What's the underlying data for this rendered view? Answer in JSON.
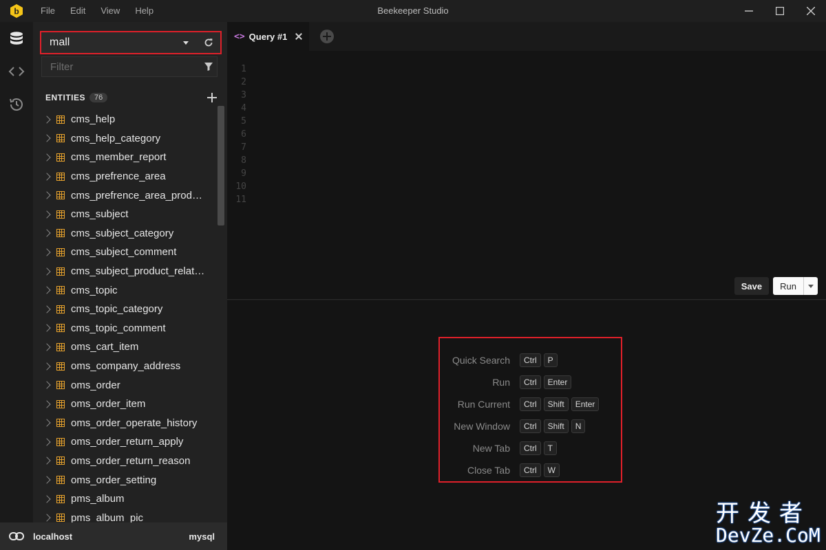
{
  "titlebar": {
    "menu": [
      "File",
      "Edit",
      "View",
      "Help"
    ],
    "title": "Beekeeper Studio"
  },
  "rail": {
    "items": [
      "database-icon",
      "code-icon",
      "history-icon"
    ]
  },
  "sidebar": {
    "database": "mall",
    "filter_placeholder": "Filter",
    "entities_label": "ENTITIES",
    "entities_count": "76",
    "tables": [
      "cms_help",
      "cms_help_category",
      "cms_member_report",
      "cms_prefrence_area",
      "cms_prefrence_area_produ…",
      "cms_subject",
      "cms_subject_category",
      "cms_subject_comment",
      "cms_subject_product_relat…",
      "cms_topic",
      "cms_topic_category",
      "cms_topic_comment",
      "oms_cart_item",
      "oms_company_address",
      "oms_order",
      "oms_order_item",
      "oms_order_operate_history",
      "oms_order_return_apply",
      "oms_order_return_reason",
      "oms_order_setting",
      "pms_album",
      "pms_album_pic"
    ]
  },
  "statusbar": {
    "host": "localhost",
    "db_type": "mysql"
  },
  "tabs": [
    {
      "label": "Query #1"
    }
  ],
  "editor": {
    "line_numbers": [
      "1",
      "2",
      "3",
      "4",
      "5",
      "6",
      "7",
      "8",
      "9",
      "10",
      "11"
    ],
    "save_label": "Save",
    "run_label": "Run"
  },
  "shortcuts": [
    {
      "name": "Quick Search",
      "keys": [
        "Ctrl",
        "P"
      ]
    },
    {
      "name": "Run",
      "keys": [
        "Ctrl",
        "Enter"
      ]
    },
    {
      "name": "Run Current",
      "keys": [
        "Ctrl",
        "Shift",
        "Enter"
      ]
    },
    {
      "name": "New Window",
      "keys": [
        "Ctrl",
        "Shift",
        "N"
      ]
    },
    {
      "name": "New Tab",
      "keys": [
        "Ctrl",
        "T"
      ]
    },
    {
      "name": "Close Tab",
      "keys": [
        "Ctrl",
        "W"
      ]
    }
  ],
  "watermark": {
    "line1": "开发者",
    "line2": "DevZe.CoM"
  },
  "colors": {
    "accent_red": "#e0202a",
    "table_icon": "#e8a32d",
    "logo_yellow": "#f5c518",
    "tab_icon": "#c678dd"
  }
}
